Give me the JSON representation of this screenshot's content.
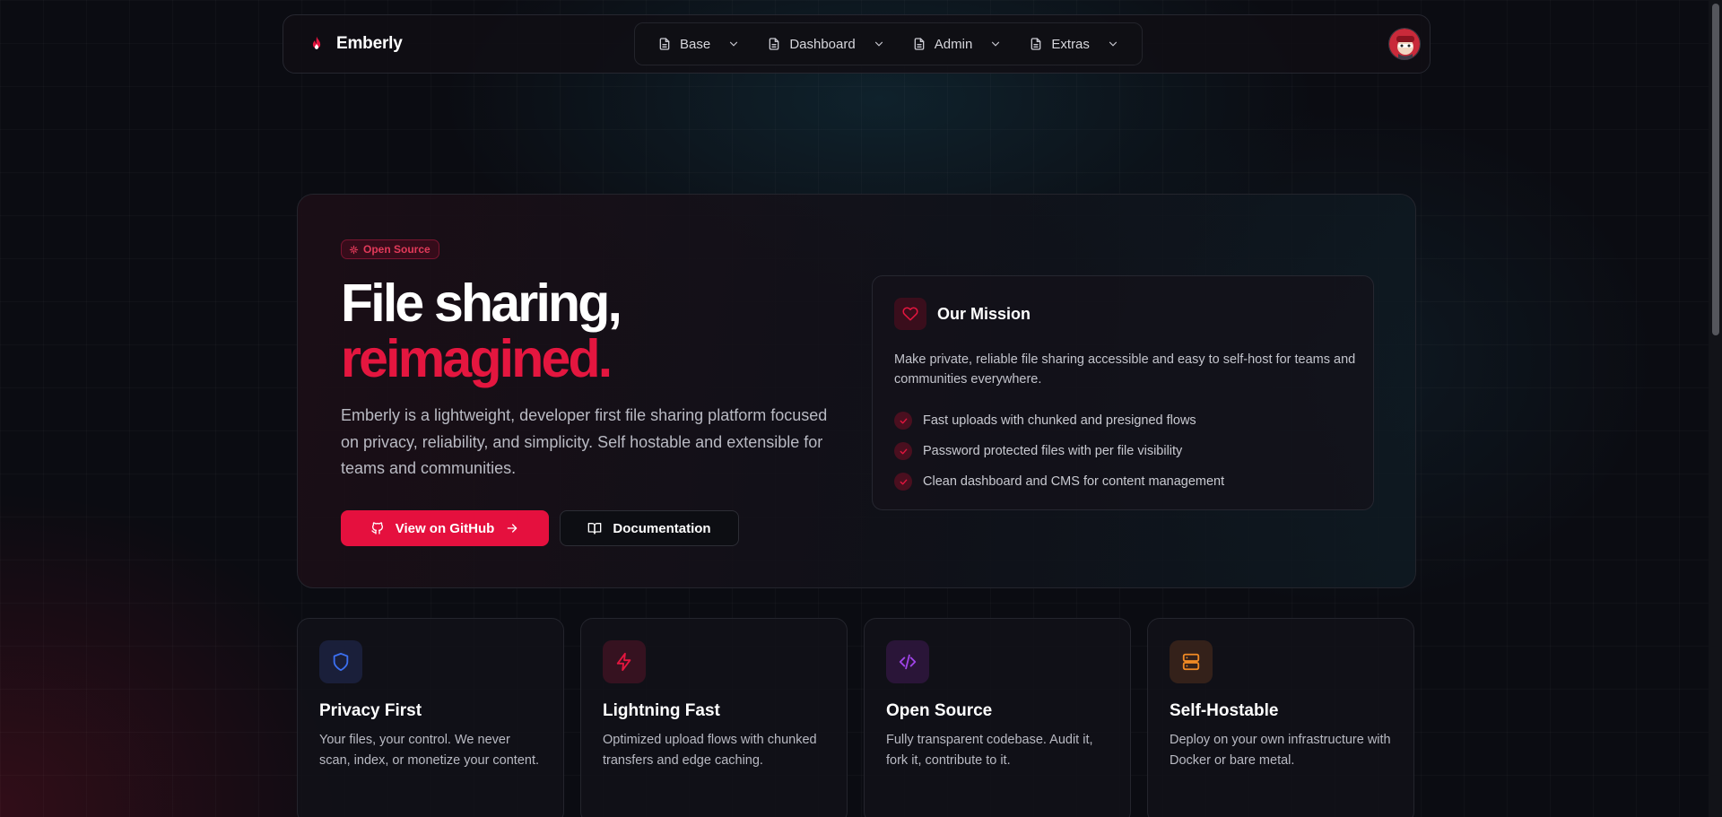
{
  "brand": {
    "name": "Emberly"
  },
  "nav": {
    "items": [
      {
        "label": "Base"
      },
      {
        "label": "Dashboard"
      },
      {
        "label": "Admin"
      },
      {
        "label": "Extras"
      }
    ]
  },
  "hero": {
    "badge": "Open Source",
    "title_line1": "File sharing,",
    "title_line2": "reimagined.",
    "description": "Emberly is a lightweight, developer first file sharing platform focused on privacy, reliability, and simplicity. Self hostable and extensible for teams and communities.",
    "primary_button": "View on GitHub",
    "secondary_button": "Documentation"
  },
  "mission": {
    "title": "Our Mission",
    "description": "Make private, reliable file sharing accessible and easy to self-host for teams and communities everywhere.",
    "points": [
      "Fast uploads with chunked and presigned flows",
      "Password protected files with per file visibility",
      "Clean dashboard and CMS for content management"
    ]
  },
  "features": [
    {
      "title": "Privacy First",
      "description": "Your files, your control. We never scan, index, or monetize your content.",
      "icon": "shield-icon",
      "color": "#3b6ff0"
    },
    {
      "title": "Lightning Fast",
      "description": "Optimized upload flows with chunked transfers and edge caching.",
      "icon": "bolt-icon",
      "color": "#e4163f"
    },
    {
      "title": "Open Source",
      "description": "Fully transparent codebase. Audit it, fork it, contribute to it.",
      "icon": "code-icon",
      "color": "#a044e8"
    },
    {
      "title": "Self-Hostable",
      "description": "Deploy on your own infrastructure with Docker or bare metal.",
      "icon": "server-icon",
      "color": "#f08a24"
    }
  ],
  "colors": {
    "accent": "#e4163f",
    "background": "#0b0c12"
  }
}
